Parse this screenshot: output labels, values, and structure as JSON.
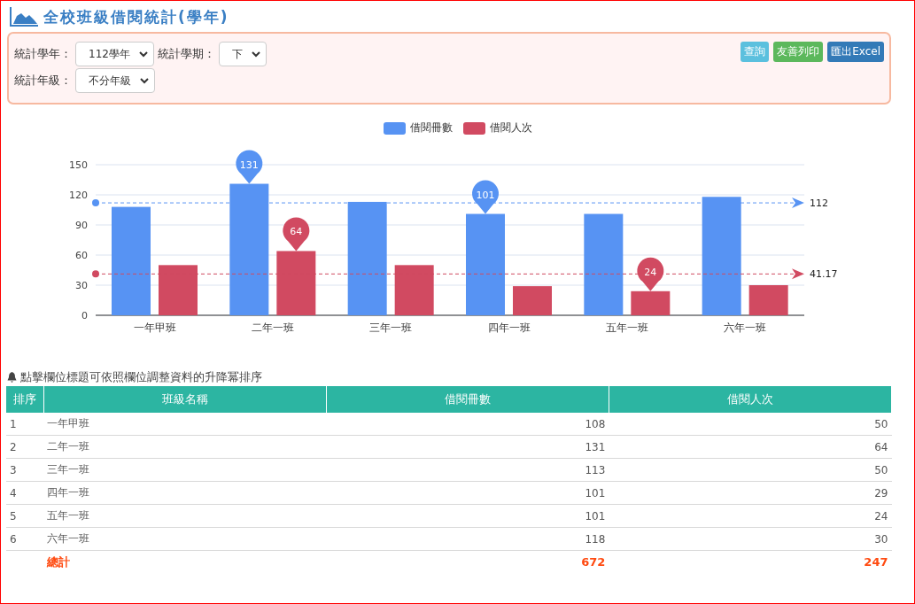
{
  "page_title": "全校班級借閱統計(學年)",
  "filters": [
    {
      "label": "統計學年：",
      "value": "112學年"
    },
    {
      "label": "統計學期：",
      "value": "下"
    },
    {
      "label": "統計年級：",
      "value": "不分年級"
    }
  ],
  "buttons": [
    {
      "label": "查詢",
      "kind": "info"
    },
    {
      "label": "友善列印",
      "kind": "success"
    },
    {
      "label": "匯出Excel",
      "kind": "primary"
    }
  ],
  "chart": {
    "chart_data": {
      "type": "bar",
      "categories": [
        "一年甲班",
        "二年一班",
        "三年一班",
        "四年一班",
        "五年一班",
        "六年一班"
      ],
      "series": [
        {
          "name": "借閱冊數",
          "color": "#5793f3",
          "values": [
            108,
            131,
            113,
            101,
            101,
            118
          ]
        },
        {
          "name": "借閱人次",
          "color": "#d14a61",
          "values": [
            50,
            64,
            50,
            29,
            24,
            30
          ]
        }
      ],
      "ylim": [
        0,
        150
      ],
      "yticks": [
        0,
        30,
        60,
        90,
        120,
        150
      ],
      "grid": true,
      "annotations": [
        {
          "text": "131",
          "x": "二年一班",
          "y": 131
        },
        {
          "text": "101",
          "x": "四年一班",
          "y": 101
        },
        {
          "text": "64",
          "x": "二年一班",
          "y": 64
        },
        {
          "text": "24",
          "x": "五年一班",
          "y": 24
        }
      ],
      "ref_lines": [
        {
          "axis": "y",
          "value": 112,
          "label": "112",
          "color": "#5793f3"
        },
        {
          "axis": "y",
          "value": 41.17,
          "label": "41.17",
          "color": "#d14a61"
        }
      ]
    }
  },
  "table_hint": "點擊欄位標題可依照欄位調整資料的升降冪排序",
  "table": {
    "columns": [
      "排序",
      "班級名稱",
      "借閱冊數",
      "借閱人次"
    ],
    "rows": [
      [
        "1",
        "一年甲班",
        "108",
        "50"
      ],
      [
        "2",
        "二年一班",
        "131",
        "64"
      ],
      [
        "3",
        "三年一班",
        "113",
        "50"
      ],
      [
        "4",
        "四年一班",
        "101",
        "29"
      ],
      [
        "5",
        "五年一班",
        "101",
        "24"
      ],
      [
        "6",
        "六年一班",
        "118",
        "30"
      ]
    ],
    "total": {
      "label": "總計",
      "books": "672",
      "visits": "247"
    }
  }
}
